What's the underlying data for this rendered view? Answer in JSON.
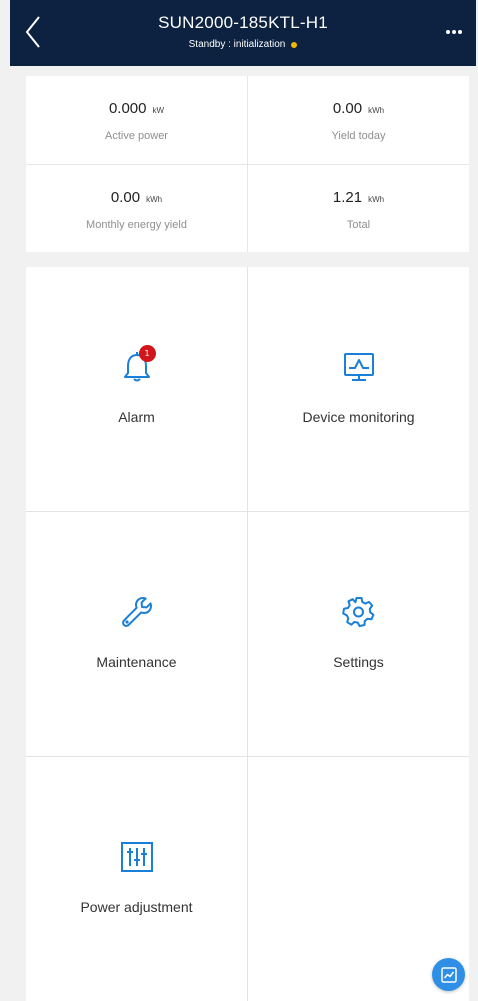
{
  "header": {
    "title": "SUN2000-185KTL-H1",
    "status": "Standby : initialization",
    "status_color": "#f5b800",
    "background": "#0c2240",
    "back_icon": "chevron-left-icon",
    "more_icon": "more-horizontal-icon"
  },
  "stats": [
    {
      "value": "0.000",
      "unit": "kW",
      "label": "Active power"
    },
    {
      "value": "0.00",
      "unit": "kWh",
      "label": "Yield today"
    },
    {
      "value": "0.00",
      "unit": "kWh",
      "label": "Monthly energy yield"
    },
    {
      "value": "1.21",
      "unit": "kWh",
      "label": "Total"
    }
  ],
  "tiles": {
    "alarm": {
      "label": "Alarm",
      "icon": "bell-icon",
      "badge": "1"
    },
    "device_monitoring": {
      "label": "Device monitoring",
      "icon": "monitor-icon"
    },
    "maintenance": {
      "label": "Maintenance",
      "icon": "wrench-icon"
    },
    "settings": {
      "label": "Settings",
      "icon": "gear-icon"
    },
    "power_adjustment": {
      "label": "Power adjustment",
      "icon": "sliders-icon"
    }
  },
  "fab": {
    "icon": "trend-chart-icon"
  },
  "colors": {
    "accent": "#1a7fd8",
    "badge": "#d0161b",
    "fab": "#2f8fe6"
  }
}
